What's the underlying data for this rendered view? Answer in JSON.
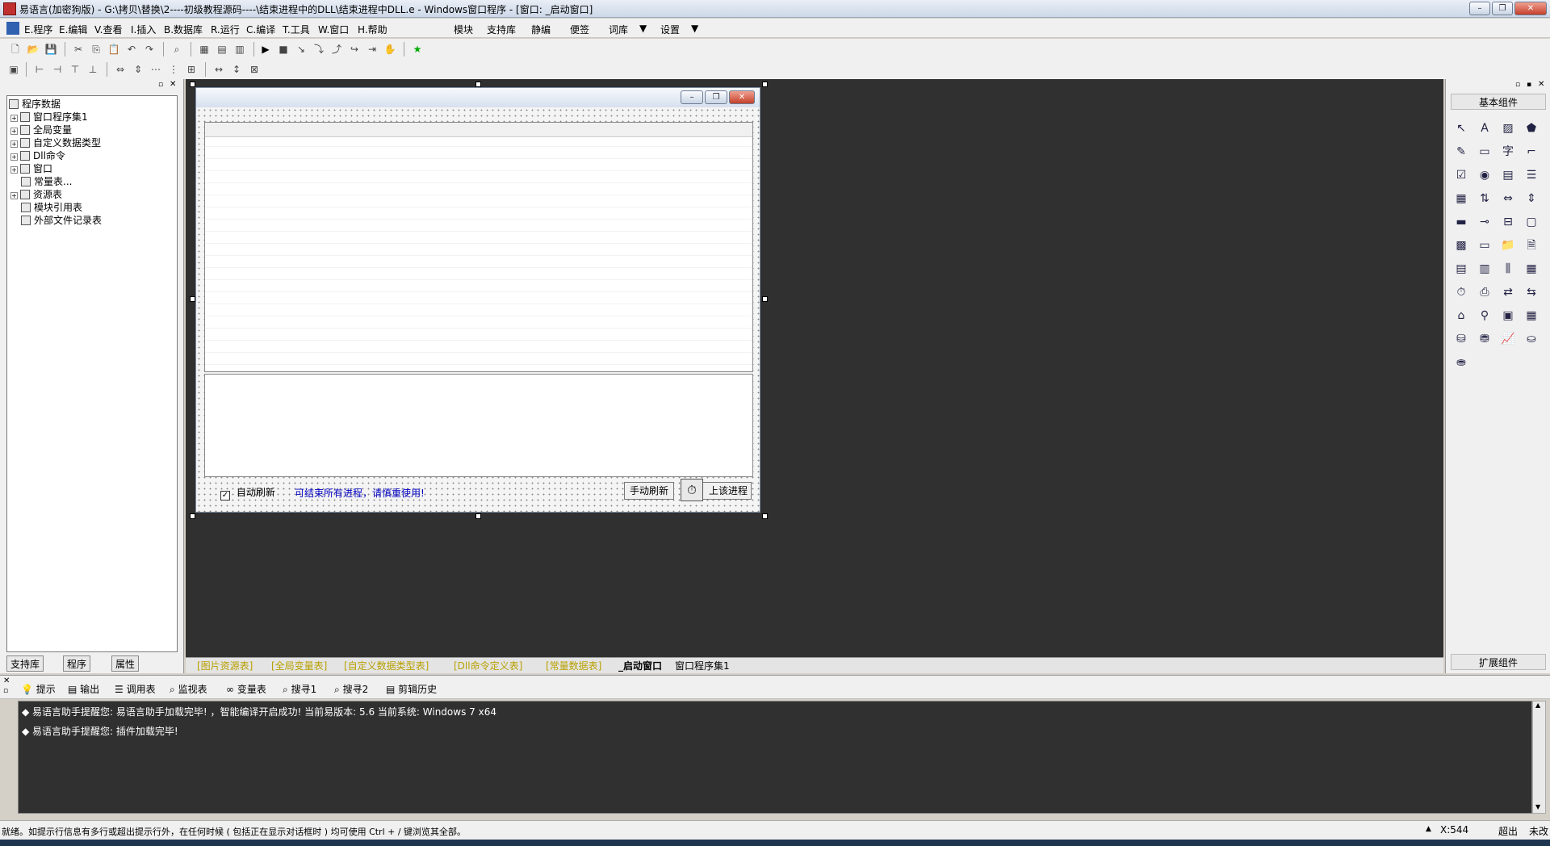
{
  "window": {
    "title": "易语言(加密狗版) - G:\\拷贝\\替换\\2----初级教程源码----\\结束进程中的DLL\\结束进程中DLL.e - Windows窗口程序 - [窗口: _启动窗口]",
    "min_label": "–",
    "max_label": "❐",
    "close_label": "✕"
  },
  "menu": {
    "items": [
      "E.程序",
      "E.编辑",
      "V.查看",
      "I.插入",
      "B.数据库",
      "R.运行",
      "C.编译",
      "T.工具",
      "W.窗口",
      "H.帮助"
    ],
    "extra_items": [
      "模块",
      "支持库",
      "静编",
      "便签",
      "词库",
      "设置"
    ]
  },
  "left_panel": {
    "tree": [
      {
        "label": "程序数据",
        "depth": 0
      },
      {
        "label": "窗口程序集1",
        "depth": 1
      },
      {
        "label": "全局变量",
        "depth": 1
      },
      {
        "label": "自定义数据类型",
        "depth": 1
      },
      {
        "label": "Dll命令",
        "depth": 1
      },
      {
        "label": "窗口",
        "depth": 1
      },
      {
        "label": "常量表...",
        "depth": 1
      },
      {
        "label": "资源表",
        "depth": 1
      },
      {
        "label": "模块引用表",
        "depth": 2
      },
      {
        "label": "外部文件记录表",
        "depth": 2
      }
    ],
    "tabs": [
      "支持库",
      "程序",
      "属性"
    ]
  },
  "form": {
    "checkbox_label": "自动刷新",
    "checkbox_checked": true,
    "info_text": "可结束所有进程，请慎重使用!",
    "refresh_button": "手动刷新",
    "end_button": "上该进程",
    "info_color": "#0000c0"
  },
  "doc_tabs": [
    "[图片资源表]",
    "[全局变量表]",
    "[自定义数据类型表]",
    "[Dll命令定义表]",
    "[常量数据表]",
    "_启动窗口",
    "窗口程序集1"
  ],
  "right_panel": {
    "header": "基本组件",
    "footer": "扩展组件"
  },
  "output_tabs": [
    "提示",
    "输出",
    "调用表",
    "监视表",
    "变量表",
    "搜寻1",
    "搜寻2",
    "剪辑历史"
  ],
  "output_lines": [
    "◆ 易语言助手提醒您: 易语言助手加载完毕! ，智能编译开启成功! 当前易版本: 5.6  当前系统: Windows 7 x64",
    "◆ 易语言助手提醒您: 插件加载完毕!"
  ],
  "status": {
    "message": "就绪。如提示行信息有多行或超出提示行外，在任何时候 ( 包括正在显示对话框时 ) 均可使用 Ctrl + / 键浏览其全部。",
    "coord": "X:544",
    "overwrite": "超出",
    "modified": "未改"
  }
}
